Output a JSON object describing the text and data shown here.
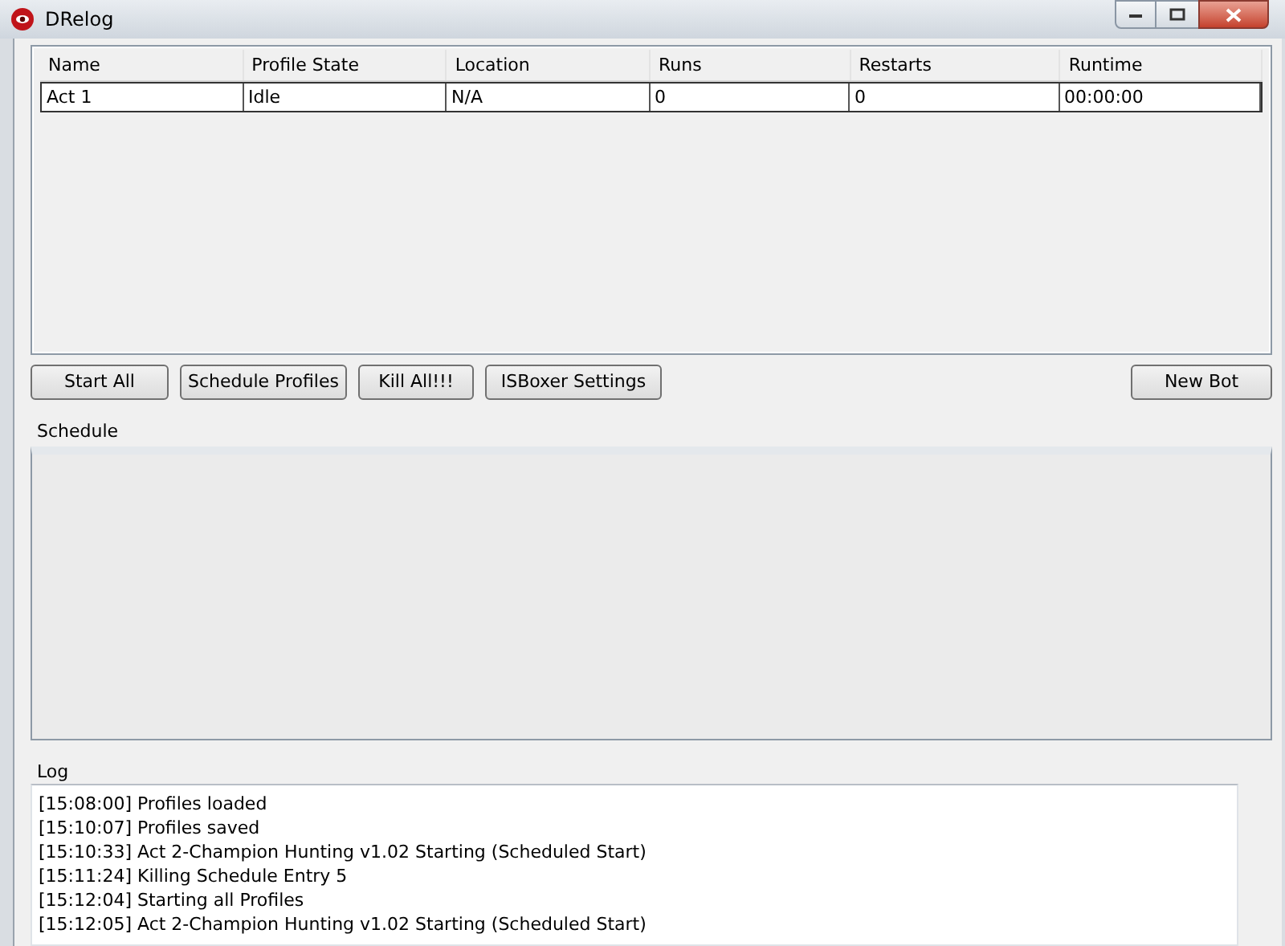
{
  "window": {
    "title": "DRelog"
  },
  "table": {
    "columns": [
      "Name",
      "Profile State",
      "Location",
      "Runs",
      "Restarts",
      "Runtime"
    ],
    "rows": [
      [
        "Act 1",
        "Idle",
        "N/A",
        "0",
        "0",
        "00:00:00"
      ]
    ]
  },
  "buttons": [
    "Start All",
    "Schedule Profiles",
    "Kill All!!!",
    "ISBoxer Settings"
  ],
  "new_bot_button": "New Bot",
  "schedule": {
    "label": "Schedule"
  },
  "log": {
    "label": "Log",
    "lines": [
      "[15:08:00] Profiles loaded",
      "[15:10:07] Profiles saved",
      "[15:10:33] Act 2-Champion Hunting v1.02 Starting (Scheduled Start)",
      "[15:11:24] Killing Schedule Entry 5",
      "[15:12:04] Starting all Profiles",
      "[15:12:05] Act 2-Champion Hunting v1.02 Starting (Scheduled Start)"
    ]
  }
}
